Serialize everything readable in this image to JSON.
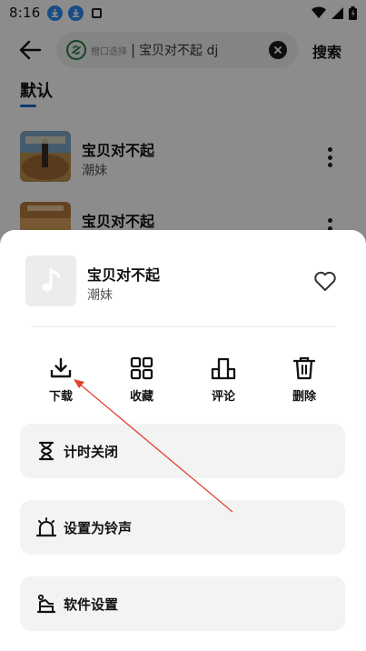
{
  "status_bar": {
    "time": "8:16"
  },
  "header": {
    "search_hint": "橙口选择",
    "search_separator": "|",
    "search_value": "宝贝对不起 dj",
    "search_button": "搜索"
  },
  "tabs": {
    "default_label": "默认"
  },
  "songs": [
    {
      "title": "宝贝对不起",
      "artist": "潮妹"
    },
    {
      "title": "宝贝对不起"
    }
  ],
  "sheet": {
    "title": "宝贝对不起",
    "artist": "潮妹",
    "actions": [
      {
        "label": "下载",
        "icon": "download-icon"
      },
      {
        "label": "收藏",
        "icon": "grid-icon"
      },
      {
        "label": "评论",
        "icon": "podium-icon"
      },
      {
        "label": "删除",
        "icon": "trash-icon"
      }
    ],
    "options": [
      {
        "label": "计时关闭",
        "icon": "hourglass-icon"
      },
      {
        "label": "设置为铃声",
        "icon": "alarm-icon"
      },
      {
        "label": "软件设置",
        "icon": "settings-icon"
      }
    ]
  },
  "colors": {
    "accent": "#1f66c7",
    "annotation": "#e0442d",
    "notification": "#2a8cf0"
  }
}
